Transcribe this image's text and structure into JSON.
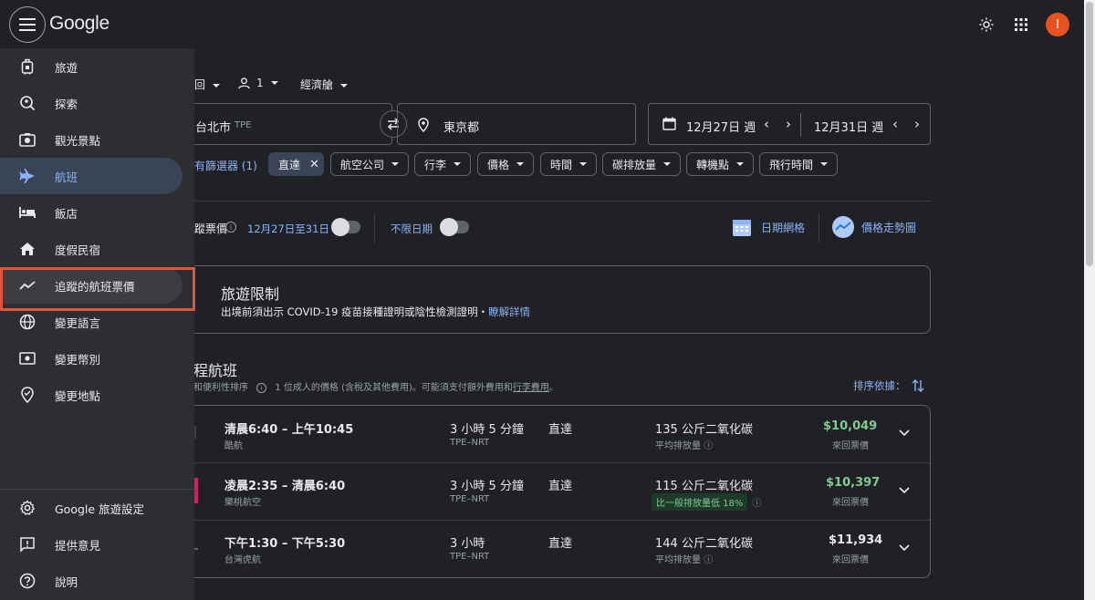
{
  "header": {
    "logo": "Google"
  },
  "sidebar": {
    "items": [
      {
        "label": "旅遊",
        "icon": "luggage-icon"
      },
      {
        "label": "探索",
        "icon": "explore-icon"
      },
      {
        "label": "觀光景點",
        "icon": "camera-icon"
      },
      {
        "label": "航班",
        "icon": "flight-icon",
        "active": true
      },
      {
        "label": "飯店",
        "icon": "hotel-bed-icon"
      },
      {
        "label": "度假民宿",
        "icon": "house-icon"
      },
      {
        "label": "追蹤的航班票價",
        "icon": "trending-icon",
        "highlighted": true
      },
      {
        "label": "變更語言",
        "icon": "globe-icon"
      },
      {
        "label": "變更幣別",
        "icon": "currency-icon"
      },
      {
        "label": "變更地點",
        "icon": "location-icon"
      }
    ],
    "footer": [
      {
        "label": "Google 旅遊設定",
        "icon": "gear-icon"
      },
      {
        "label": "提供意見",
        "icon": "feedback-icon"
      },
      {
        "label": "說明",
        "icon": "help-icon"
      }
    ]
  },
  "search": {
    "trip_type": "回",
    "passengers": "1",
    "cabin": "經濟艙",
    "origin": "台北市",
    "origin_code": "TPE",
    "destination": "東京都",
    "depart_date": "12月27日 週",
    "return_date": "12月31日 週"
  },
  "filters": {
    "all_filters": "有篩選器 (1)",
    "selected": "直達",
    "chips": [
      "航空公司",
      "行李",
      "價格",
      "時間",
      "碳排放量",
      "轉機點",
      "飛行時間"
    ]
  },
  "tracking": {
    "label": "蹤票價",
    "date_range": "12月27日至31日",
    "any_dates": "不限日期",
    "date_grid": "日期網格",
    "price_graph": "價格走勢圖"
  },
  "notice": {
    "title": "旅遊限制",
    "body": "出境前須出示 COVID-19 疫苗接種證明或陰性檢測證明・",
    "link": "瞭解詳情"
  },
  "results": {
    "title": "程航班",
    "sort_note": "和便利性排序",
    "price_note_prefix": "1 位成人的價格 (含稅及其他費用)。可能須支付額外費用和",
    "price_note_link": "行李費用",
    "price_note_suffix": "。",
    "sort_by": "排序依據：",
    "flights": [
      {
        "times": "清晨6:40 – 上午10:45",
        "airline": "酷航",
        "duration": "3 小時 5 分鐘",
        "route": "TPE–NRT",
        "stops": "直達",
        "emissions": "135 公斤二氧化碳",
        "emissions_note": "平均排放量",
        "badge": "",
        "price": "$10,049",
        "price_label": "來回票價",
        "price_green": true
      },
      {
        "times": "凌晨2:35 – 清晨6:40",
        "airline": "樂桃航空",
        "duration": "3 小時 5 分鐘",
        "route": "TPE–NRT",
        "stops": "直達",
        "emissions": "115 公斤二氧化碳",
        "emissions_note": "",
        "badge": "比一般排放量低 18%",
        "price": "$10,397",
        "price_label": "來回票價",
        "price_green": true
      },
      {
        "times": "下午1:30 – 下午5:30",
        "airline": "台灣虎航",
        "duration": "3 小時",
        "route": "TPE–NRT",
        "stops": "直達",
        "emissions": "144 公斤二氧化碳",
        "emissions_note": "平均排放量",
        "badge": "",
        "price": "$11,934",
        "price_label": "來回票價",
        "price_green": false
      }
    ]
  },
  "colors": {
    "background": "#202124",
    "sidebar": "#2d2e31",
    "accent": "#8ab4f8",
    "active_nav": "#394457",
    "highlight_box": "#e5533d",
    "price_green": "#81c995",
    "avatar": "#e8521f"
  }
}
